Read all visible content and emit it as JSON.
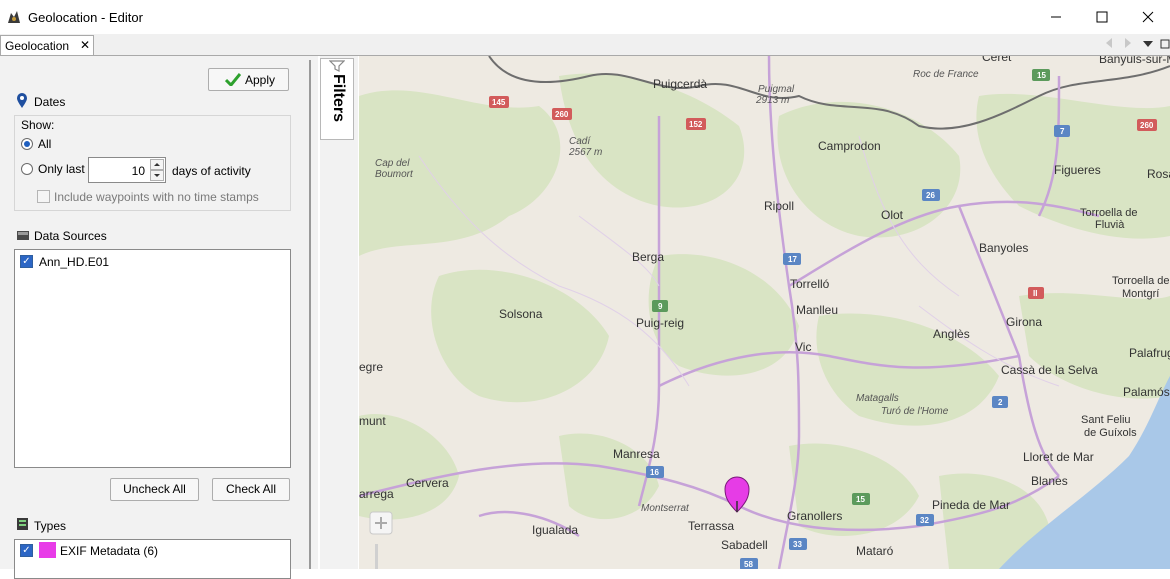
{
  "window": {
    "title": "Geolocation - Editor",
    "minimize_glyph": "—",
    "maximize_glyph": "☐",
    "close_glyph": "✕"
  },
  "tab": {
    "label": "Geolocation",
    "close_glyph": "✕"
  },
  "filters_panel": {
    "apply_label": "Apply",
    "dates": {
      "title": "Dates",
      "show_label": "Show:",
      "all_label": "All",
      "only_last_label": "Only last",
      "days_value": "10",
      "days_suffix": "days of activity",
      "include_label": "Include waypoints with no time stamps",
      "selected": "All"
    },
    "data_sources": {
      "title": "Data Sources",
      "items": [
        {
          "label": "Ann_HD.E01",
          "checked": true
        }
      ],
      "uncheck_all_label": "Uncheck All",
      "check_all_label": "Check All"
    },
    "types": {
      "title": "Types",
      "items": [
        {
          "label": "EXIF Metadata (6)",
          "checked": true,
          "color": "#e83ce8"
        }
      ]
    }
  },
  "filters_tab_label": "Filters",
  "map": {
    "colors": {
      "land": "#eeeae2",
      "forest": "#d9e4c4",
      "water": "#a9c8e8",
      "major_road": "#c6a2d8",
      "border": "#6e6e6e",
      "marker": "#e63ce6"
    },
    "towns": [
      "Puigcerdà",
      "Camprodon",
      "Figueres",
      "Ripoll",
      "Olot",
      "Berga",
      "Torrelló",
      "Banyoles",
      "Solsona",
      "Puig-reig",
      "Manlleu",
      "Girona",
      "Vic",
      "Anglès",
      "Cassà de la Selva",
      "Manresa",
      "Cervera",
      "Terrassa",
      "Granollers",
      "Sabadell",
      "Igualada",
      "Mataró",
      "Lloret de Mar",
      "Blanes",
      "Pineda de Mar",
      "Palamós",
      "Palafrugell",
      "Banyuls-sur-Mer",
      "Céret",
      "Rosa",
      "egre",
      "munt",
      "arrega",
      "Torroella de Fluvià",
      "Torroella de Montgrí",
      "Sant Feliu de Guíxols"
    ],
    "peaks": [
      "Cadí 2567 m",
      "Puigmal 2913 m",
      "Cap del Boumort",
      "Roc de France",
      "Matagalls",
      "Turó de l'Home",
      "Montserrat"
    ],
    "road_shields": [
      "145",
      "260",
      "152",
      "15",
      "7",
      "260",
      "26",
      "17",
      "9",
      "II",
      "2",
      "16",
      "15",
      "32",
      "33",
      "58"
    ],
    "zoom_in_glyph": "+"
  }
}
